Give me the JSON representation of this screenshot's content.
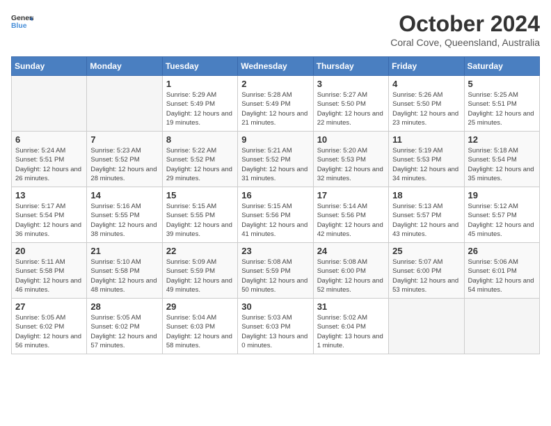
{
  "logo": {
    "line1": "General",
    "line2": "Blue"
  },
  "title": "October 2024",
  "subtitle": "Coral Cove, Queensland, Australia",
  "days_of_week": [
    "Sunday",
    "Monday",
    "Tuesday",
    "Wednesday",
    "Thursday",
    "Friday",
    "Saturday"
  ],
  "weeks": [
    [
      {
        "day": "",
        "empty": true
      },
      {
        "day": "",
        "empty": true
      },
      {
        "day": "1",
        "sunrise": "5:29 AM",
        "sunset": "5:49 PM",
        "daylight": "12 hours and 19 minutes."
      },
      {
        "day": "2",
        "sunrise": "5:28 AM",
        "sunset": "5:49 PM",
        "daylight": "12 hours and 21 minutes."
      },
      {
        "day": "3",
        "sunrise": "5:27 AM",
        "sunset": "5:50 PM",
        "daylight": "12 hours and 22 minutes."
      },
      {
        "day": "4",
        "sunrise": "5:26 AM",
        "sunset": "5:50 PM",
        "daylight": "12 hours and 23 minutes."
      },
      {
        "day": "5",
        "sunrise": "5:25 AM",
        "sunset": "5:51 PM",
        "daylight": "12 hours and 25 minutes."
      }
    ],
    [
      {
        "day": "6",
        "sunrise": "5:24 AM",
        "sunset": "5:51 PM",
        "daylight": "12 hours and 26 minutes."
      },
      {
        "day": "7",
        "sunrise": "5:23 AM",
        "sunset": "5:52 PM",
        "daylight": "12 hours and 28 minutes."
      },
      {
        "day": "8",
        "sunrise": "5:22 AM",
        "sunset": "5:52 PM",
        "daylight": "12 hours and 29 minutes."
      },
      {
        "day": "9",
        "sunrise": "5:21 AM",
        "sunset": "5:52 PM",
        "daylight": "12 hours and 31 minutes."
      },
      {
        "day": "10",
        "sunrise": "5:20 AM",
        "sunset": "5:53 PM",
        "daylight": "12 hours and 32 minutes."
      },
      {
        "day": "11",
        "sunrise": "5:19 AM",
        "sunset": "5:53 PM",
        "daylight": "12 hours and 34 minutes."
      },
      {
        "day": "12",
        "sunrise": "5:18 AM",
        "sunset": "5:54 PM",
        "daylight": "12 hours and 35 minutes."
      }
    ],
    [
      {
        "day": "13",
        "sunrise": "5:17 AM",
        "sunset": "5:54 PM",
        "daylight": "12 hours and 36 minutes."
      },
      {
        "day": "14",
        "sunrise": "5:16 AM",
        "sunset": "5:55 PM",
        "daylight": "12 hours and 38 minutes."
      },
      {
        "day": "15",
        "sunrise": "5:15 AM",
        "sunset": "5:55 PM",
        "daylight": "12 hours and 39 minutes."
      },
      {
        "day": "16",
        "sunrise": "5:15 AM",
        "sunset": "5:56 PM",
        "daylight": "12 hours and 41 minutes."
      },
      {
        "day": "17",
        "sunrise": "5:14 AM",
        "sunset": "5:56 PM",
        "daylight": "12 hours and 42 minutes."
      },
      {
        "day": "18",
        "sunrise": "5:13 AM",
        "sunset": "5:57 PM",
        "daylight": "12 hours and 43 minutes."
      },
      {
        "day": "19",
        "sunrise": "5:12 AM",
        "sunset": "5:57 PM",
        "daylight": "12 hours and 45 minutes."
      }
    ],
    [
      {
        "day": "20",
        "sunrise": "5:11 AM",
        "sunset": "5:58 PM",
        "daylight": "12 hours and 46 minutes."
      },
      {
        "day": "21",
        "sunrise": "5:10 AM",
        "sunset": "5:58 PM",
        "daylight": "12 hours and 48 minutes."
      },
      {
        "day": "22",
        "sunrise": "5:09 AM",
        "sunset": "5:59 PM",
        "daylight": "12 hours and 49 minutes."
      },
      {
        "day": "23",
        "sunrise": "5:08 AM",
        "sunset": "5:59 PM",
        "daylight": "12 hours and 50 minutes."
      },
      {
        "day": "24",
        "sunrise": "5:08 AM",
        "sunset": "6:00 PM",
        "daylight": "12 hours and 52 minutes."
      },
      {
        "day": "25",
        "sunrise": "5:07 AM",
        "sunset": "6:00 PM",
        "daylight": "12 hours and 53 minutes."
      },
      {
        "day": "26",
        "sunrise": "5:06 AM",
        "sunset": "6:01 PM",
        "daylight": "12 hours and 54 minutes."
      }
    ],
    [
      {
        "day": "27",
        "sunrise": "5:05 AM",
        "sunset": "6:02 PM",
        "daylight": "12 hours and 56 minutes."
      },
      {
        "day": "28",
        "sunrise": "5:05 AM",
        "sunset": "6:02 PM",
        "daylight": "12 hours and 57 minutes."
      },
      {
        "day": "29",
        "sunrise": "5:04 AM",
        "sunset": "6:03 PM",
        "daylight": "12 hours and 58 minutes."
      },
      {
        "day": "30",
        "sunrise": "5:03 AM",
        "sunset": "6:03 PM",
        "daylight": "13 hours and 0 minutes."
      },
      {
        "day": "31",
        "sunrise": "5:02 AM",
        "sunset": "6:04 PM",
        "daylight": "13 hours and 1 minute."
      },
      {
        "day": "",
        "empty": true
      },
      {
        "day": "",
        "empty": true
      }
    ]
  ],
  "labels": {
    "sunrise": "Sunrise:",
    "sunset": "Sunset:",
    "daylight": "Daylight:"
  }
}
